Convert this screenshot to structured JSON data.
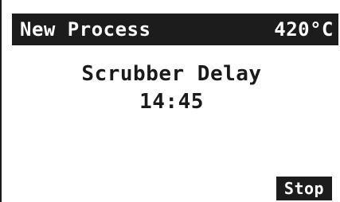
{
  "header": {
    "title": "New Process",
    "temperature": "420°C"
  },
  "status": {
    "label": "Scrubber Delay",
    "time": "14:45"
  },
  "softkeys": {
    "stop_label": "Stop"
  },
  "colors": {
    "bar_background": "#1c1c1c",
    "bar_text": "#ffffff",
    "screen_background": "#ffffff",
    "text": "#1a1a1a"
  }
}
